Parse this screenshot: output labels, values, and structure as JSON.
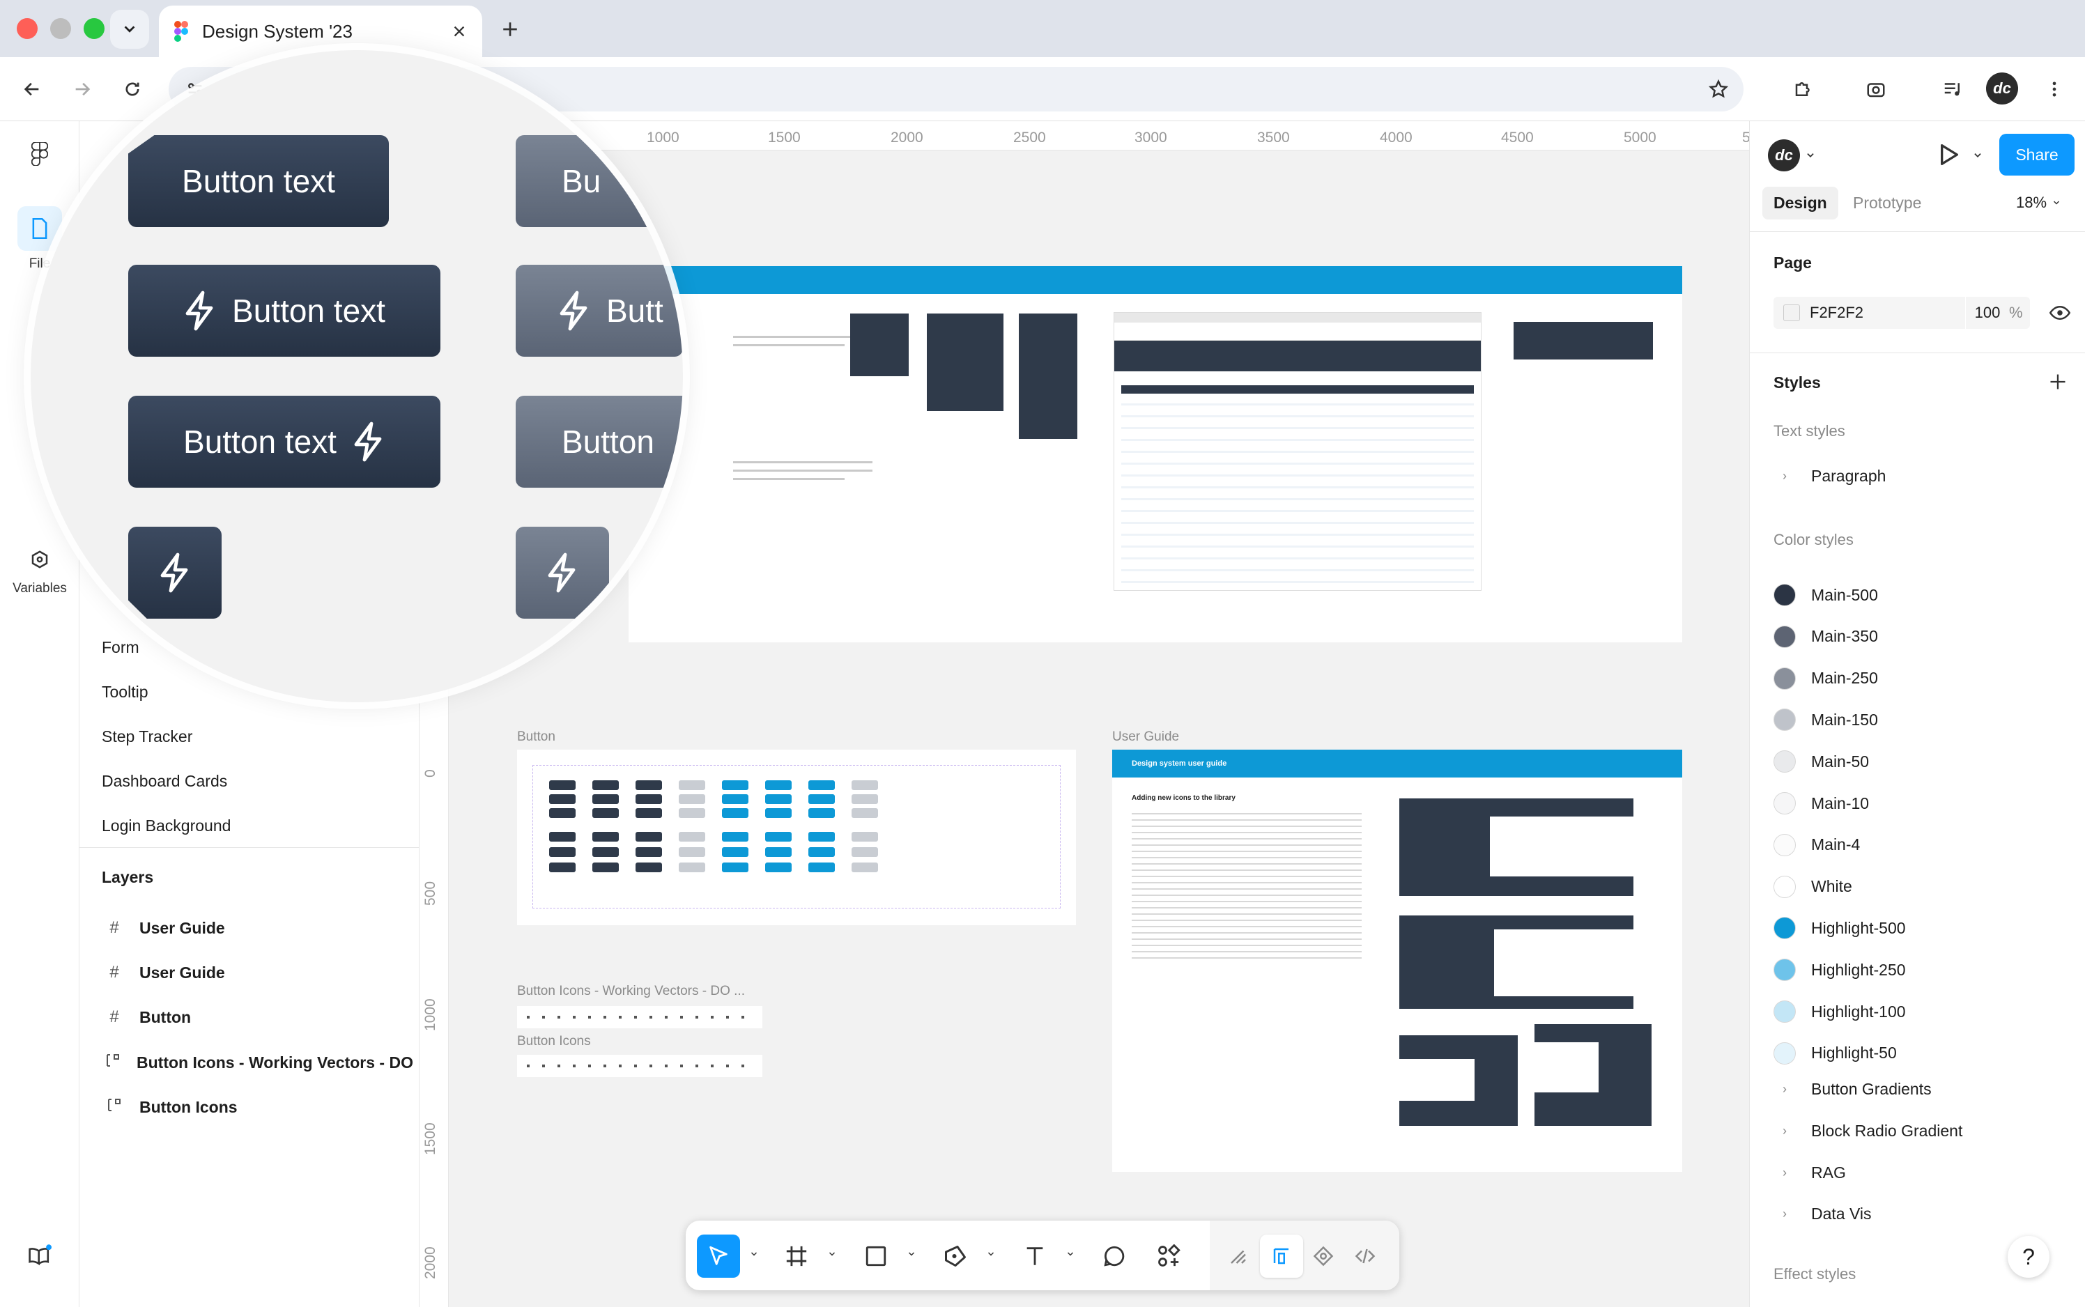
{
  "browser": {
    "tab_title": "Design System '23",
    "omnibox_icon": "site-settings-icon"
  },
  "rail": {
    "file_label": "File",
    "variables_label": "Variables"
  },
  "pages": [
    {
      "label": "Form"
    },
    {
      "label": "Tooltip"
    },
    {
      "label": "Step Tracker"
    },
    {
      "label": "Dashboard Cards"
    },
    {
      "label": "Login Background"
    }
  ],
  "layers": {
    "title": "Layers",
    "items": [
      {
        "label": "User Guide",
        "icon": "frame-icon"
      },
      {
        "label": "User Guide",
        "icon": "frame-icon"
      },
      {
        "label": "Button",
        "icon": "frame-icon"
      },
      {
        "label": "Button Icons - Working Vectors - DO N",
        "icon": "section-icon"
      },
      {
        "label": "Button Icons",
        "icon": "section-icon"
      }
    ]
  },
  "canvas": {
    "ruler_top": [
      "1000",
      "1500",
      "2000",
      "2500",
      "3000",
      "3500",
      "4000",
      "4500",
      "5000",
      "5"
    ],
    "ruler_left": [
      "0",
      "500",
      "1000",
      "1500",
      "2000"
    ],
    "frames": {
      "button": "Button",
      "user_guide": "User Guide",
      "icons_working": "Button Icons - Working Vectors - DO ...",
      "icons": "Button Icons",
      "user_guide_header": "Design system user guide",
      "user_guide_heading": "Adding new icons to the library"
    }
  },
  "magnifier": {
    "button_text": "Button text",
    "button_text_cropped": "Button",
    "button_text_cropped_short": "Bu",
    "button_text_cropped_mid": "Butt"
  },
  "right_panel": {
    "avatar_initials": "dc",
    "share_label": "Share",
    "tabs": {
      "design": "Design",
      "prototype": "Prototype"
    },
    "zoom": "18%",
    "page": {
      "title": "Page",
      "color": "F2F2F2",
      "opacity": "100",
      "percent": "%"
    },
    "styles": {
      "title": "Styles",
      "text_styles_title": "Text styles",
      "text_styles": [
        "Paragraph"
      ],
      "color_styles_title": "Color styles",
      "colors": [
        {
          "name": "Main-500",
          "hex": "#2b3444"
        },
        {
          "name": "Main-350",
          "hex": "#5d6473"
        },
        {
          "name": "Main-250",
          "hex": "#8a909b"
        },
        {
          "name": "Main-150",
          "hex": "#bfc3ca"
        },
        {
          "name": "Main-50",
          "hex": "#e9eaec"
        },
        {
          "name": "Main-10",
          "hex": "#f6f6f7"
        },
        {
          "name": "Main-4",
          "hex": "#fbfbfb"
        },
        {
          "name": "White",
          "hex": "#ffffff"
        },
        {
          "name": "Highlight-500",
          "hex": "#0d99d6"
        },
        {
          "name": "Highlight-250",
          "hex": "#6ec3ea"
        },
        {
          "name": "Highlight-100",
          "hex": "#c3e6f6"
        },
        {
          "name": "Highlight-50",
          "hex": "#e3f3fb"
        }
      ],
      "groups": [
        "Button Gradients",
        "Block Radio Gradient",
        "RAG",
        "Data Vis"
      ],
      "effect_styles_title": "Effect styles"
    },
    "help": "?"
  },
  "colors": {
    "accent": "#0d99ff",
    "highlight": "#0d99d6",
    "canvas_bg": "#f2f2f2"
  }
}
